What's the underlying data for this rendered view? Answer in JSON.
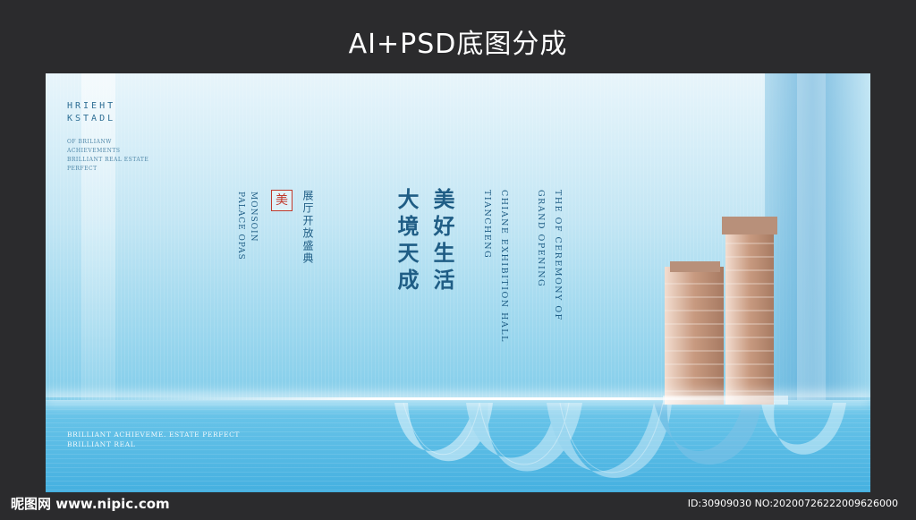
{
  "header": {
    "title": "AI+PSD底图分成"
  },
  "poster": {
    "brand_line1": "HRIEHT",
    "brand_line2": "KSTADL",
    "small_en": [
      "OF BRILIANW",
      "ACHIEVEMENTS",
      "BRILLIANT REAL ESTATE",
      "PERFECT"
    ],
    "bottom_en": [
      "BRILLIANT ACHIEVEME. ESTATE PERFECT",
      "BRILLIANT REAL"
    ],
    "vertical_en_left": [
      "MONSOIN",
      "PALACE OPAS"
    ],
    "seal_char": "美",
    "event_zh": "展厅开放盛典",
    "headline_1": "大境天成",
    "headline_2": "美好生活",
    "vertical_en_mid": [
      "CHIANE EXHIBITION HALL",
      "TIANCHENG"
    ],
    "vertical_en_right": [
      "THE OF CEREMONY OF",
      "GRAND OPENING"
    ]
  },
  "footer": {
    "watermark": "昵图网 www.nipic.com",
    "id_text": "ID:30909030 NO:20200726222009626000"
  }
}
